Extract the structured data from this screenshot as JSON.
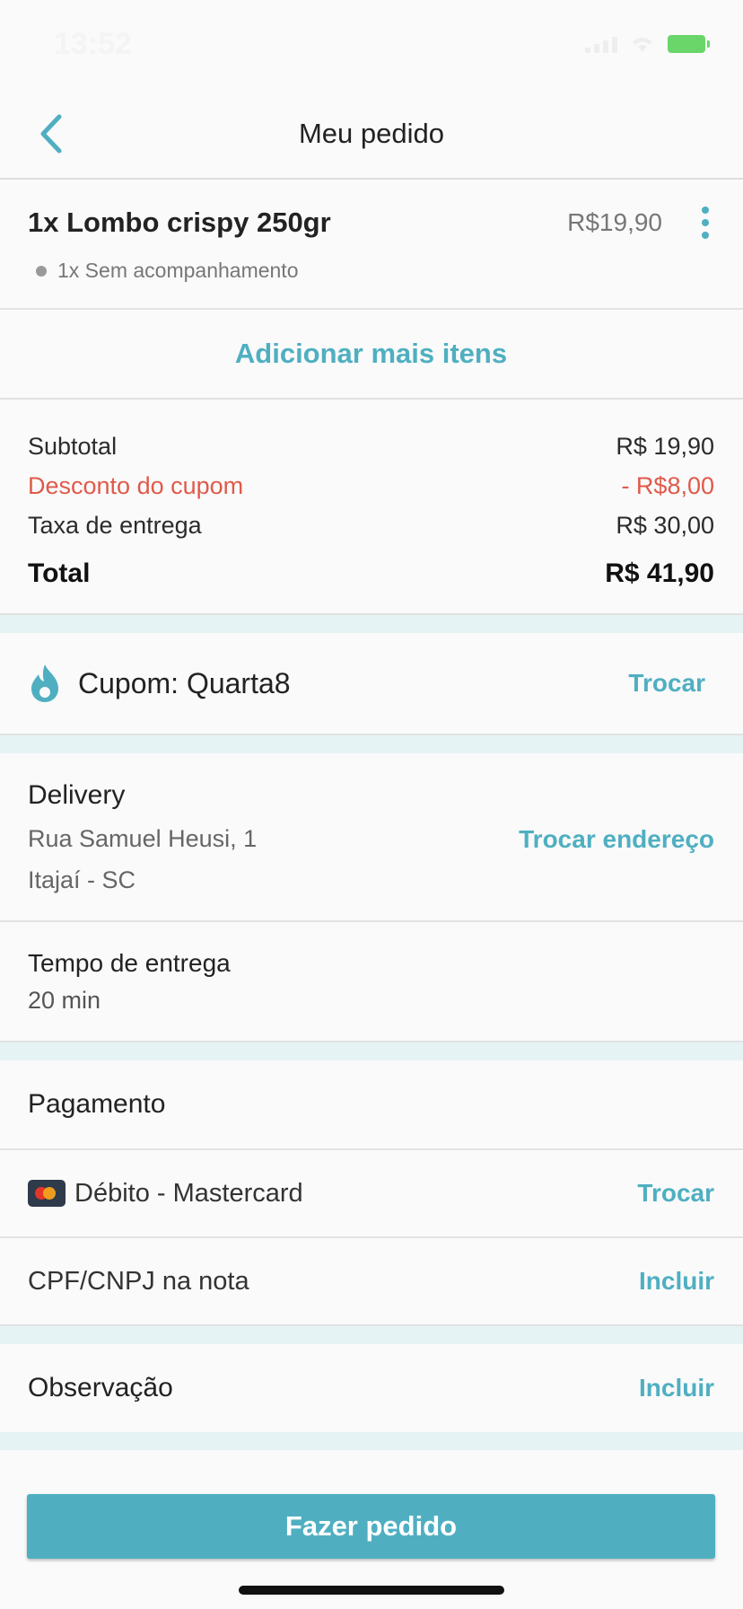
{
  "status_bar": {
    "time": "13:52"
  },
  "header": {
    "title": "Meu pedido"
  },
  "order_item": {
    "name": "1x Lombo crispy 250gr",
    "price": "R$19,90",
    "option": "1x Sem acompanhamento"
  },
  "add_more_label": "Adicionar mais itens",
  "summary": {
    "subtotal_label": "Subtotal",
    "subtotal_value": "R$ 19,90",
    "discount_label": "Desconto do cupom",
    "discount_value": "- R$8,00",
    "fee_label": "Taxa de entrega",
    "fee_value": "R$ 30,00",
    "total_label": "Total",
    "total_value": "R$ 41,90"
  },
  "coupon": {
    "label": "Cupom: Quarta8",
    "action": "Trocar"
  },
  "delivery": {
    "title": "Delivery",
    "address_line1": "Rua Samuel Heusi, 1",
    "address_line2": "Itajaí - SC",
    "action": "Trocar endereço"
  },
  "delivery_time": {
    "title": "Tempo de entrega",
    "value": "20 min"
  },
  "payment": {
    "title": "Pagamento",
    "method": "Débito - Mastercard",
    "method_action": "Trocar",
    "tax_id_label": "CPF/CNPJ na nota",
    "tax_id_action": "Incluir"
  },
  "note": {
    "label": "Observação",
    "action": "Incluir"
  },
  "submit_label": "Fazer pedido",
  "colors": {
    "accent": "#4fafc1",
    "discount": "#e05a4a",
    "section_gap": "#e6f3f5"
  }
}
